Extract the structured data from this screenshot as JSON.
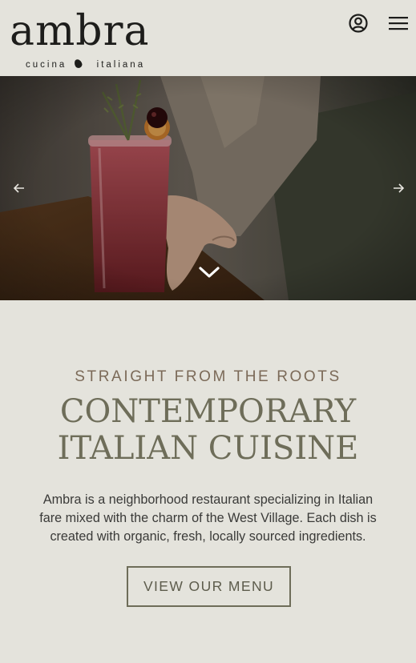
{
  "brand": {
    "name": "ambra",
    "tagline_left": "cucina",
    "tagline_right": "italiana"
  },
  "header": {
    "icons": [
      "account-icon",
      "hamburger-menu-icon"
    ]
  },
  "hero": {
    "icons": [
      "arrow-left-icon",
      "arrow-right-icon",
      "chevron-down-icon"
    ]
  },
  "intro": {
    "eyebrow": "STRAIGHT FROM THE ROOTS",
    "headline_line1": "CONTEMPORARY",
    "headline_line2": "ITALIAN CUISINE",
    "body_line1": "Ambra is a neighborhood restaurant specializing in Italian",
    "body_line2": "fare mixed with the charm of the West Village. Each dish is",
    "body_line3": "created with organic, fresh, locally sourced ingredients.",
    "cta_label": "VIEW OUR MENU"
  },
  "colors": {
    "background": "#e4e3dc",
    "eyebrow": "#7b6a58",
    "headline": "#6e6d59",
    "body_text": "#3a3a38",
    "logo": "#1d1d1b"
  }
}
